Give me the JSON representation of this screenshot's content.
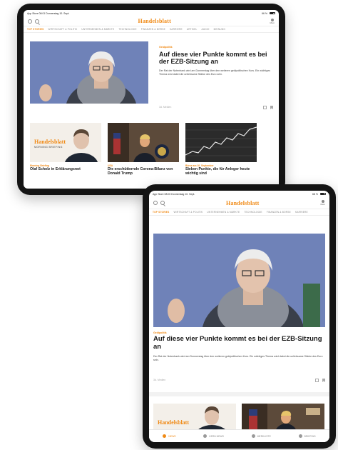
{
  "status_land": {
    "left": "App Store 08:01 Donnerstag 10. Sept.",
    "right": "66 %"
  },
  "status_port": {
    "left": "App Store 08:00 Donnerstag 10. Sept.",
    "right": "68 %"
  },
  "logo": "Handelsblatt",
  "profile_label": "Mein",
  "tabs_land": [
    "TOP STORIES",
    "WIRTSCHAFT & POLITIK",
    "UNTERNEHMEN & MÄRKTE",
    "TECHNOLOGIE",
    "FINANZEN & BÖRSE",
    "KARRIERE",
    "ARTIKEL",
    "AUDIO",
    "MEINUNG"
  ],
  "tabs_port": [
    "TOP STORIES",
    "WIRTSCHAFT & POLITIK",
    "UNTERNEHMEN & MÄRKTE",
    "TECHNOLOGIE",
    "FINANZEN & BÖRSE",
    "KARRIERE"
  ],
  "hero": {
    "kicker": "Geldpolitik",
    "headline": "Auf diese vier Punkte kommt es bei der EZB-Sitzung an",
    "teaser": "Der Rat der Notenbank wird am Donnerstag über den weiteren geldpolitischen Kurs. Ein wichtiges Thema wird dabei die unliebsame Stärke des Euro sein.",
    "meta": "3d. Medien"
  },
  "cards": [
    {
      "kicker": "Morning Briefing",
      "headline": "Olaf Scholz in Erklärungsnot",
      "logo": "Handelsblatt",
      "sub": "MORNING BRIEFING"
    },
    {
      "kicker": "USA",
      "headline": "Die erschütternde Corona-Bilanz von Donald Trump"
    },
    {
      "kicker": "Börse am 10. September",
      "headline": "Sieben Punkte, die für Anleger heute wichtig sind"
    }
  ],
  "bottom_nav": [
    "NEWS",
    "KERN NEWS",
    "MERKLISTE",
    "BRIEFING"
  ],
  "colors": {
    "accent": "#f08a16",
    "hero_bg": "#6f82b8",
    "chart_bg": "#2b2b2b"
  }
}
